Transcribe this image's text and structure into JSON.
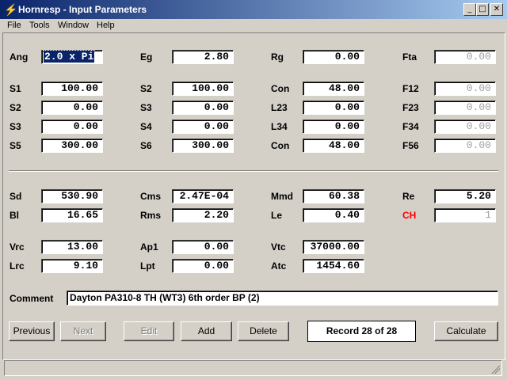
{
  "window": {
    "title": "Hornresp - Input Parameters",
    "min": "_",
    "max": "□",
    "close": "✕"
  },
  "menu": [
    "File",
    "Tools",
    "Window",
    "Help"
  ],
  "fields": {
    "ang": {
      "label": "Ang",
      "value": "2.0 x Pi"
    },
    "eg": {
      "label": "Eg",
      "value": "2.80"
    },
    "rg": {
      "label": "Rg",
      "value": "0.00"
    },
    "fta": {
      "label": "Fta",
      "value": "0.00"
    },
    "s1": {
      "label": "S1",
      "value": "100.00"
    },
    "s2b": {
      "label": "S2",
      "value": "100.00"
    },
    "con1": {
      "label": "Con",
      "value": "48.00"
    },
    "f12": {
      "label": "F12",
      "value": "0.00"
    },
    "s2": {
      "label": "S2",
      "value": "0.00"
    },
    "s3b": {
      "label": "S3",
      "value": "0.00"
    },
    "l23": {
      "label": "L23",
      "value": "0.00"
    },
    "f23": {
      "label": "F23",
      "value": "0.00"
    },
    "s3": {
      "label": "S3",
      "value": "0.00"
    },
    "s4": {
      "label": "S4",
      "value": "0.00"
    },
    "l34": {
      "label": "L34",
      "value": "0.00"
    },
    "f34": {
      "label": "F34",
      "value": "0.00"
    },
    "s5": {
      "label": "S5",
      "value": "300.00"
    },
    "s6": {
      "label": "S6",
      "value": "300.00"
    },
    "con2": {
      "label": "Con",
      "value": "48.00"
    },
    "f56": {
      "label": "F56",
      "value": "0.00"
    },
    "sd": {
      "label": "Sd",
      "value": "530.90"
    },
    "cms": {
      "label": "Cms",
      "value": "2.47E-04"
    },
    "mmd": {
      "label": "Mmd",
      "value": "60.38"
    },
    "re": {
      "label": "Re",
      "value": "5.20"
    },
    "bl": {
      "label": "Bl",
      "value": "16.65"
    },
    "rms": {
      "label": "Rms",
      "value": "2.20"
    },
    "le": {
      "label": "Le",
      "value": "0.40"
    },
    "ch": {
      "label": "CH",
      "value": "1"
    },
    "vrc": {
      "label": "Vrc",
      "value": "13.00"
    },
    "ap1": {
      "label": "Ap1",
      "value": "0.00"
    },
    "vtc": {
      "label": "Vtc",
      "value": "37000.00"
    },
    "lrc": {
      "label": "Lrc",
      "value": "9.10"
    },
    "lpt": {
      "label": "Lpt",
      "value": "0.00"
    },
    "atc": {
      "label": "Atc",
      "value": "1454.60"
    }
  },
  "comment": {
    "label": "Comment",
    "value": "Dayton PA310-8 TH (WT3) 6th order BP (2)"
  },
  "buttons": {
    "previous": "Previous",
    "next": "Next",
    "edit": "Edit",
    "add": "Add",
    "delete": "Delete",
    "calculate": "Calculate"
  },
  "record": "Record 28 of 28"
}
